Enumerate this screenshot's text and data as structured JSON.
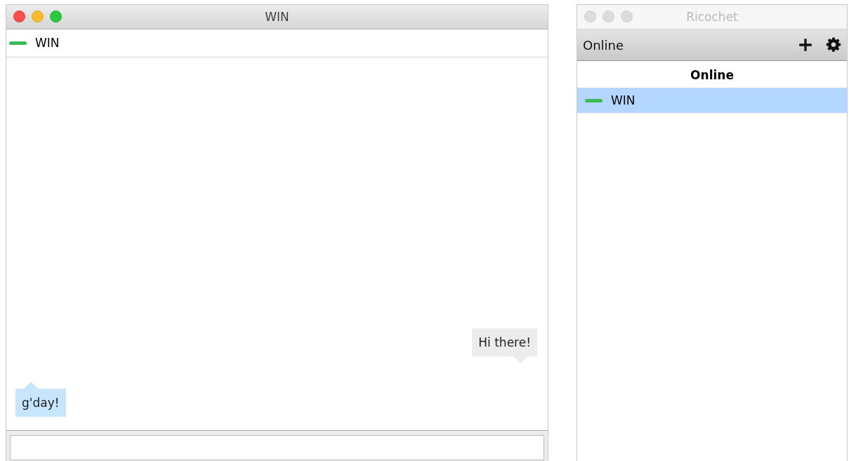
{
  "chat_window": {
    "title": "WIN",
    "contact": {
      "name": "WIN",
      "color": "#3cba54"
    },
    "messages": [
      {
        "kind": "outgoing",
        "text": "Hi there!"
      },
      {
        "kind": "incoming",
        "text": "g'day!"
      }
    ]
  },
  "contacts_window": {
    "title": "Ricochet",
    "toolbar": {
      "status": "Online"
    },
    "groups": [
      {
        "heading": "Online",
        "contacts": [
          {
            "name": "WIN",
            "color": "#3cba54",
            "selected": true
          }
        ]
      }
    ]
  }
}
